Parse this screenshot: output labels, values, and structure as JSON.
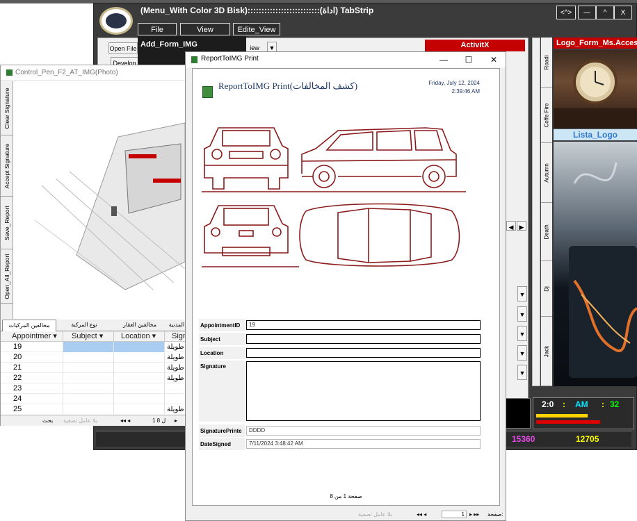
{
  "main_form": {
    "title": "(Menu_With Color 3D Bisk)::::::::::::::::::::::::::(اداة) TabStrip",
    "window_buttons": [
      "<^>",
      "—",
      "^",
      "X"
    ],
    "menu": [
      "File",
      "View",
      "Edite_View"
    ],
    "dropdown_item": "Add_Form_IMG",
    "open_file": "Open File",
    "develop": "Develop",
    "view_tab": "iew",
    "activitx": "ActivitX",
    "vertical_tabs": [
      "Roadi",
      "Coffe Fire",
      "Autumn",
      "Death",
      "Dj",
      "Jack"
    ],
    "logo_label": "Logo_Form_Ms.Access",
    "lista_label": "Lista_Logo",
    "clock": {
      "hour": "2:0",
      "ampm": "AM",
      "sec": "32"
    },
    "status_numbers": [
      "15360",
      "12705"
    ]
  },
  "photo_window": {
    "title": "Control_Pen_F2_AT_IMG(Photo)",
    "side_buttons": [
      "Clear Signature",
      "Accept Signature",
      "Save_Report",
      "Open_All_Report"
    ],
    "tabs": [
      "مخالفين المركبات",
      "نوع المركبة",
      "مخالفين العقار",
      "المدنية"
    ],
    "columns": [
      "Appointmer",
      "Subject",
      "Location",
      "Sign"
    ],
    "rows": [
      {
        "id": "19",
        "sig": "طويلة"
      },
      {
        "id": "20",
        "sig": "طويلة"
      },
      {
        "id": "21",
        "sig": "طويلة"
      },
      {
        "id": "22",
        "sig": "طويلة"
      },
      {
        "id": "23",
        "sig": ""
      },
      {
        "id": "24",
        "sig": ""
      },
      {
        "id": "25",
        "sig": "طويلة"
      }
    ],
    "nav": {
      "search": "بحث",
      "filter": "بلا عامل تصفية",
      "record": "1 ل 8"
    }
  },
  "report_window": {
    "title": "ReportToIMG Print",
    "heading": "ReportToIMG Print(كشف المخالفات)",
    "date": "Friday, July 12, 2024",
    "time": "2:39:46 AM",
    "fields": [
      {
        "label": "AppointmentID",
        "value": "19"
      },
      {
        "label": "Subject",
        "value": ""
      },
      {
        "label": "Location",
        "value": ""
      },
      {
        "label": "Signature",
        "value": ""
      },
      {
        "label": "SignaturePrinte",
        "value": "DDDD"
      },
      {
        "label": "DateSigned",
        "value": "7/11/2024 3:48:42 AM"
      }
    ],
    "footer": "صفحة 1 من 8",
    "nav": {
      "page_label": "صفحة:",
      "page": "1",
      "filter": "بلا عامل تصفية"
    }
  },
  "colors": {
    "accent_red": "#c40000",
    "car_line": "#8b1a1a",
    "form_dark": "#3b3b3b"
  }
}
